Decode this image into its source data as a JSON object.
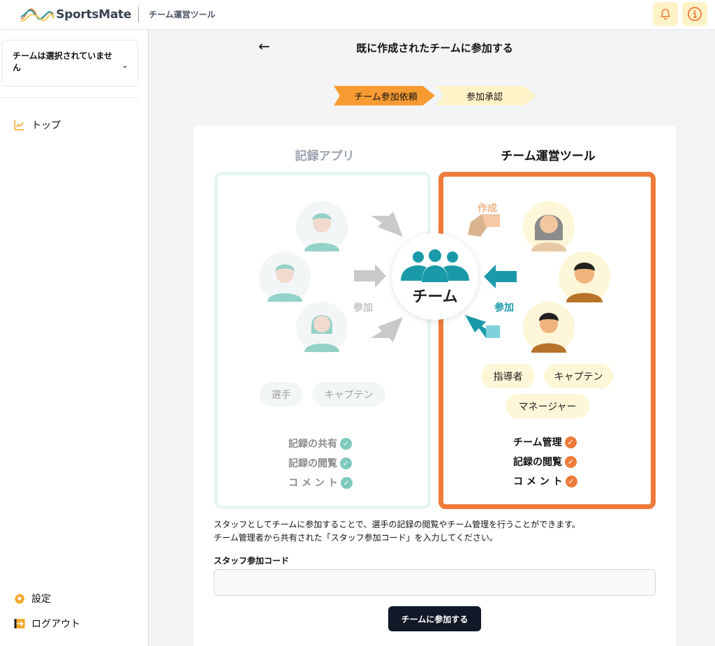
{
  "header": {
    "logo_text": "SportsMate",
    "subtitle": "チーム運営ツール",
    "bell_icon": "bell-icon",
    "info_icon": "info-icon"
  },
  "sidebar": {
    "team_select": "チームは選択されていません",
    "items": [
      {
        "label": "トップ",
        "icon": "chart-line-icon"
      },
      {
        "label": "設定",
        "icon": "gear-icon"
      },
      {
        "label": "ログアウト",
        "icon": "logout-icon"
      }
    ]
  },
  "main": {
    "title": "既に作成されたチームに参加する",
    "steps": [
      "チーム参加依頼",
      "参加承認"
    ],
    "diagram": {
      "left_title": "記録アプリ",
      "right_title": "チーム運営ツール",
      "team_label": "チーム",
      "left_arrow_label": "参加",
      "right_create_label": "作成",
      "right_join_label": "参加",
      "left_roles": [
        "選手",
        "キャプテン"
      ],
      "right_roles": [
        "指導者",
        "キャプテン",
        "マネージャー"
      ],
      "left_features": [
        "記録の共有",
        "記録の閲覧",
        "コ メ ン ト"
      ],
      "right_features": [
        "チーム管理",
        "記録の閲覧",
        "コ メ ン ト"
      ]
    },
    "description_1": "スタッフとしてチームに参加することで、選手の記録の閲覧やチーム管理を行うことができます。",
    "description_2": "チーム管理者から共有された「スタッフ参加コード」を入力してください。",
    "code_label": "スタッフ参加コード",
    "code_value": "",
    "code_placeholder": "",
    "join_button": "チームに参加する"
  },
  "colors": {
    "accent_orange": "#ee7b3b",
    "step_active": "#f89b33",
    "step_inactive": "#fef3c7",
    "teal": "#1a9aa8"
  }
}
